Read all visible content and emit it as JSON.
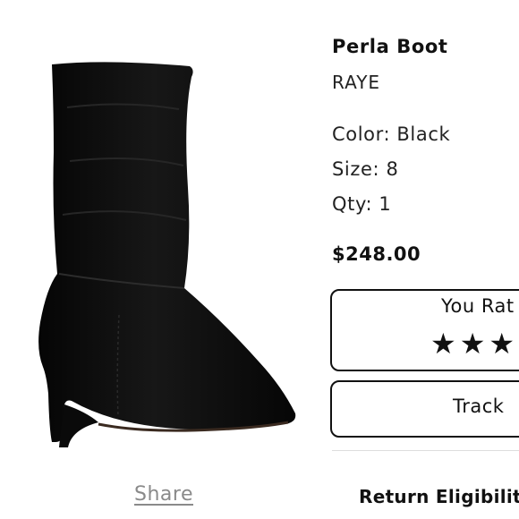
{
  "product": {
    "name": "Perla Boot",
    "brand": "RAYE",
    "color_line": "Color: Black",
    "size_line": "Size: 8",
    "qty_line": "Qty: 1",
    "price": "$248.00",
    "image_icon": "black-suede-pointed-toe-boot"
  },
  "rating": {
    "label": "You Rat",
    "stars": "★★★",
    "value": 3,
    "max": 5
  },
  "actions": {
    "track_label": "Track",
    "share_label": "Share",
    "return_label": "Return Eligibilit"
  }
}
